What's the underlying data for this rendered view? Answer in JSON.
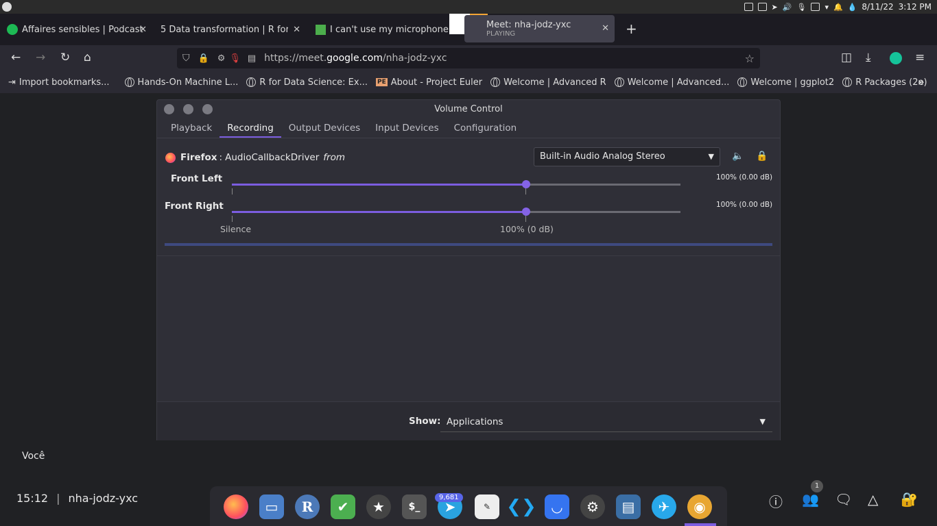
{
  "sysbar": {
    "date": "8/11/22",
    "time": "3:12 PM"
  },
  "tabs": [
    {
      "label": "Affaires sensibles | Podcast",
      "close": "✕"
    },
    {
      "label": "5 Data transformation | R for Data Science",
      "close": "✕"
    },
    {
      "label": "I can't use my microphone",
      "close": ""
    },
    {
      "label": "Meet: nha-jodz-yxc",
      "sub": "PLAYING",
      "close": "✕"
    }
  ],
  "new_tab": "+",
  "nav": {
    "url_prefix": "https://meet.",
    "url_domain": "google.com",
    "url_path": "/nha-jodz-yxc"
  },
  "bookmarks": [
    "Import bookmarks...",
    "Hands-On Machine L...",
    "R for Data Science: Ex...",
    "About - Project Euler",
    "Welcome | Advanced R",
    "Welcome | Advanced...",
    "Welcome | ggplot2",
    "R Packages (2e)"
  ],
  "pe_badge": "PE",
  "window": {
    "title": "Volume Control",
    "tabs": [
      "Playback",
      "Recording",
      "Output Devices",
      "Input Devices",
      "Configuration"
    ],
    "stream": {
      "app": "Firefox",
      "separator": ":",
      "name": "AudioCallbackDriver",
      "from": "from",
      "device": "Built-in Audio Analog Stereo",
      "channels": [
        {
          "label": "Front Left",
          "value": "100% (0.00 dB)",
          "level": 1.0
        },
        {
          "label": "Front Right",
          "value": "100% (0.00 dB)",
          "level": 1.0
        }
      ],
      "scale_left": "Silence",
      "scale_mid": "100% (0 dB)"
    },
    "show_label": "Show:",
    "show_value": "Applications"
  },
  "meet": {
    "you_label": "Você",
    "time": "15:12",
    "separator": "|",
    "code": "nha-jodz-yxc",
    "people_count": "1"
  },
  "dock": {
    "badge": "9,681",
    "r_label": "R",
    "terminal": "$_"
  },
  "colors": {
    "accent": "#7c5de0",
    "lock": "#f2c12e"
  }
}
